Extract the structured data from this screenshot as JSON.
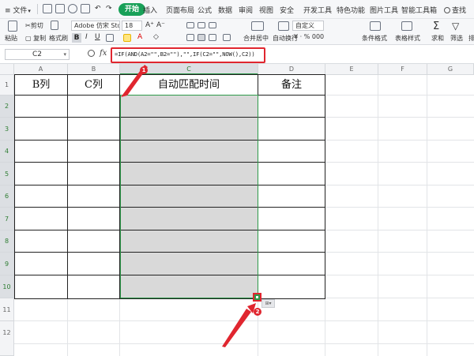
{
  "menu": {
    "file_label": "文件",
    "tabs": [
      "开始",
      "插入",
      "页面布局",
      "公式",
      "数据",
      "审阅",
      "视图",
      "安全",
      "开发工具",
      "特色功能",
      "图片工具",
      "智能工具箱"
    ],
    "search_label": "查找"
  },
  "ribbon": {
    "paste": "粘贴",
    "cut": "剪切",
    "copy": "复制",
    "format_painter": "格式刷",
    "font_name": "Adobe 仿宋 Std R",
    "font_size": "18",
    "merge_center": "合并居中",
    "auto_wrap": "自动换行",
    "number_format": "自定义",
    "conditional_format": "条件格式",
    "table_style": "表格样式",
    "sum": "求和",
    "filter": "筛选",
    "sort": "排序",
    "bold": "B",
    "italic": "I",
    "underline": "U"
  },
  "formula_bar": {
    "name_box": "C2",
    "fx": "fx",
    "formula": "=IF(AND(A2=\"\",B2=\"\"),\"\",IF(C2=\"\",NOW(),C2))"
  },
  "grid": {
    "columns": [
      "A",
      "B",
      "C",
      "D",
      "E",
      "F",
      "G"
    ],
    "rows": [
      "1",
      "2",
      "3",
      "4",
      "5",
      "6",
      "7",
      "8",
      "9",
      "10",
      "11",
      "12"
    ],
    "headers": [
      "B列",
      "C列",
      "自动匹配时间",
      "备注"
    ]
  },
  "annotations": {
    "badge1": "1",
    "badge2": "2",
    "accent_color": "#e0262f",
    "selection_color": "#2e9a4a"
  }
}
